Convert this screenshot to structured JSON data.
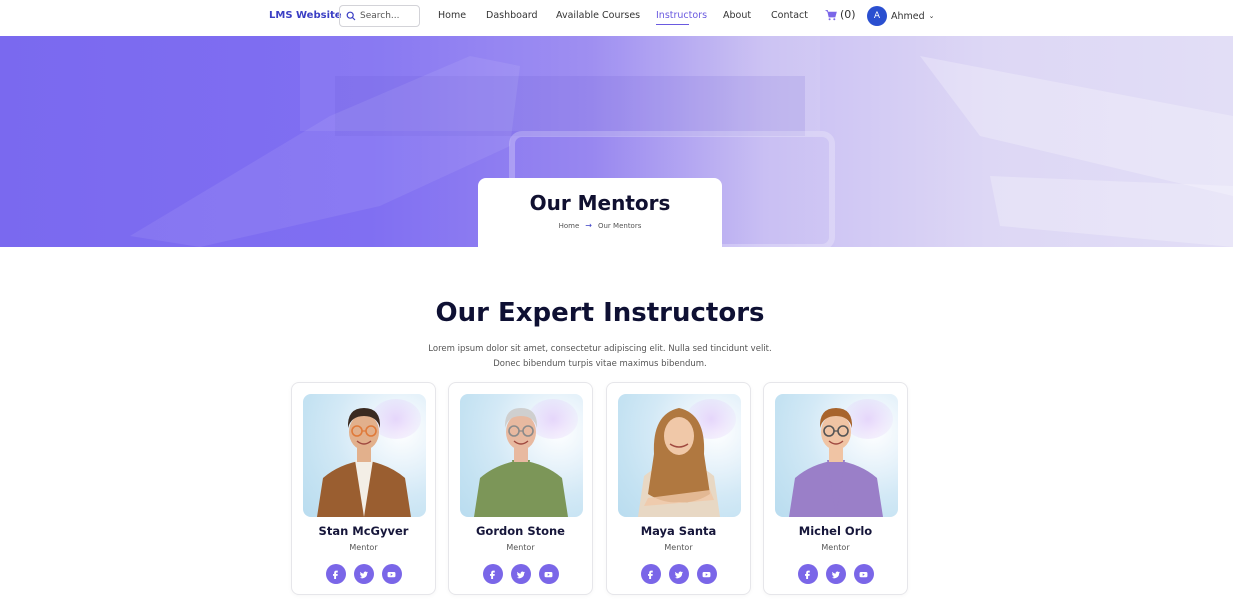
{
  "nav": {
    "brand": "LMS Website",
    "search_placeholder": "Search...",
    "links": [
      {
        "label": "Home",
        "active": false
      },
      {
        "label": "Dashboard",
        "active": false
      },
      {
        "label": "Available Courses",
        "active": false
      },
      {
        "label": "Instructors",
        "active": true
      },
      {
        "label": "About",
        "active": false
      },
      {
        "label": "Contact",
        "active": false
      }
    ],
    "cart_count": "(0)",
    "user": {
      "initial": "A",
      "name": "Ahmed"
    }
  },
  "hero": {
    "title": "Our Mentors",
    "breadcrumb": [
      "Home",
      "Our Mentors"
    ],
    "breadcrumb_separator": "→"
  },
  "section": {
    "title": "Our Expert Instructors",
    "description": "Lorem ipsum dolor sit amet, consectetur adipiscing elit. Nulla sed tincidunt velit. Donec bibendum turpis vitae maximus bibendum."
  },
  "instructors": [
    {
      "name": "Stan McGyver",
      "role": "Mentor",
      "socials": [
        "facebook",
        "twitter",
        "youtube"
      ]
    },
    {
      "name": "Gordon Stone",
      "role": "Mentor",
      "socials": [
        "facebook",
        "twitter",
        "youtube"
      ]
    },
    {
      "name": "Maya Santa",
      "role": "Mentor",
      "socials": [
        "facebook",
        "twitter",
        "youtube"
      ]
    },
    {
      "name": "Michel Orlo",
      "role": "Mentor",
      "socials": [
        "facebook",
        "twitter",
        "youtube"
      ]
    }
  ],
  "colors": {
    "accent": "#6a5ae0",
    "social_button": "#7a66e8",
    "brand": "#3b3fc4",
    "avatar": "#2a4fd0",
    "heading": "#0e1033"
  }
}
